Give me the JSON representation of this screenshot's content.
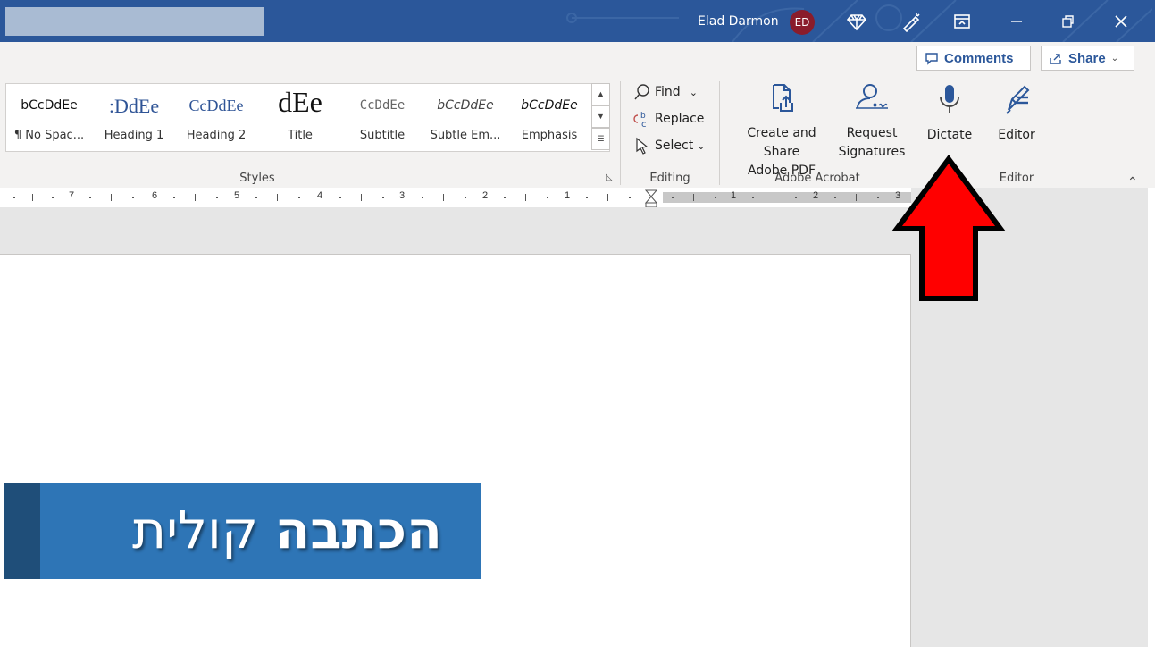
{
  "titlebar": {
    "user_name": "Elad Darmon",
    "avatar_initials": "ED",
    "bg_color": "#2b579a"
  },
  "ribbon_top": {
    "comments_label": "Comments",
    "share_label": "Share"
  },
  "styles": {
    "group_label": "Styles",
    "items": [
      {
        "sample": "bCcDdEe",
        "label": "¶ No Spac..."
      },
      {
        "sample": ":DdEe",
        "label": "Heading 1"
      },
      {
        "sample": "CcDdEe",
        "label": "Heading 2"
      },
      {
        "sample": "dEe",
        "label": "Title"
      },
      {
        "sample": "CcDdEe",
        "label": "Subtitle"
      },
      {
        "sample": "bCcDdEe",
        "label": "Subtle Em..."
      },
      {
        "sample": "bCcDdEe",
        "label": "Emphasis"
      }
    ]
  },
  "editing": {
    "group_label": "Editing",
    "find": "Find",
    "replace": "Replace",
    "select": "Select"
  },
  "acrobat": {
    "group_label": "Adobe Acrobat",
    "create_line1": "Create and Share",
    "create_line2": "Adobe PDF",
    "request_line1": "Request",
    "request_line2": "Signatures"
  },
  "voice": {
    "dictate": "Dictate"
  },
  "editor": {
    "label": "Editor",
    "group_label": "Editor"
  },
  "ruler": {
    "numbers": [
      "7",
      "6",
      "5",
      "4",
      "3",
      "2",
      "1",
      "1",
      "2",
      "3"
    ]
  },
  "banner": {
    "bold_word": "הכתבה",
    "word": "קולית"
  }
}
